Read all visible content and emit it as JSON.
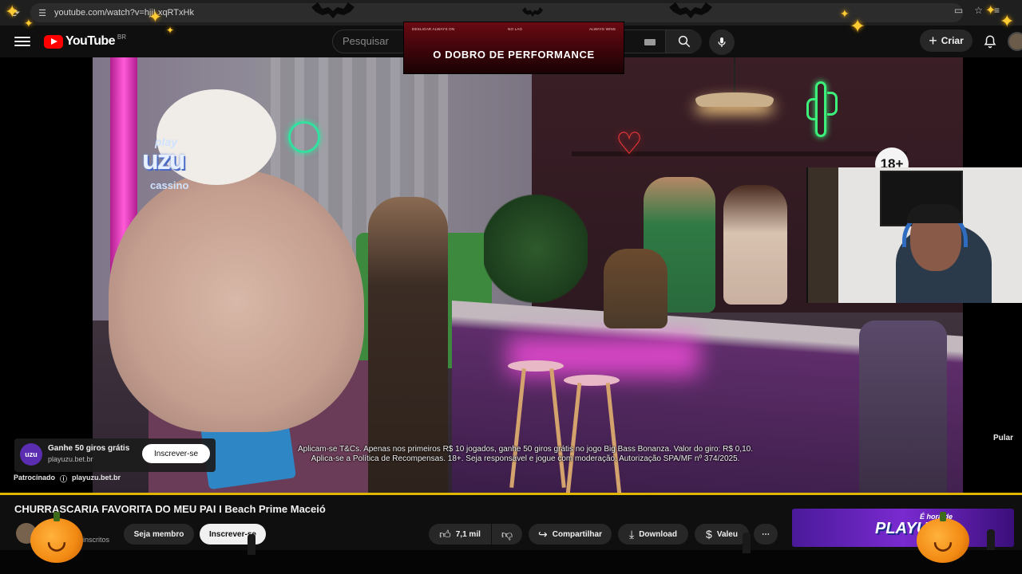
{
  "browser": {
    "url": "youtube.com/watch?v=hjjLxqRTxHk",
    "reload_icon": "reload-icon",
    "site_info_icon": "site-info-icon"
  },
  "header": {
    "logo_text": "YouTube",
    "region": "BR",
    "search_placeholder": "Pesquisar",
    "create_label": "Criar",
    "icons": [
      "menu-icon",
      "search-icon",
      "mic-icon",
      "bell-icon"
    ]
  },
  "top_ad": {
    "small_1": "DESLIGAR ALWAYS ON",
    "small_2": "NO LAG",
    "small_3": "ALWAYS WINS",
    "headline": "O DOBRO DE PERFORMANCE"
  },
  "video_overlay": {
    "brand_line1": "play",
    "brand_line2": "uzu",
    "brand_line3": "cassino",
    "age_badge": "18+",
    "disclaimer_1": "Aplicam-se T&Cs. Apenas nos primeiros R$ 10 jogados, ganhe 50 giros grátis no jogo Big Bass Bonanza. Valor do giro: R$ 0,10.",
    "disclaimer_2": "Aplica-se a Política de Recompensas. 18+. Seja responsável e jogue com moderação. Autorização SPA/MF nº 374/2025.",
    "skip_label": "Pular"
  },
  "ad_card": {
    "logo_text": "uzu",
    "title": "Ganhe 50 giros grátis",
    "domain": "playuzu.bet.br",
    "cta": "Inscrever-se",
    "sponsored_label": "Patrocinado",
    "sponsored_domain": "playuzu.bet.br"
  },
  "video_info": {
    "title": "CHURRASCARIA FAVORITA DO MEU PAI I Beach Prime Maceió",
    "subscribers": "inscritos",
    "join_label": "Seja membro",
    "subscribe_label": "Inscrever-se",
    "likes": "7,1 mil",
    "share_label": "Compartilhar",
    "download_label": "Download",
    "thanks_label": "Valeu"
  },
  "sidebar_ad": {
    "small": "É hora de",
    "brand": "PLAYUZU"
  },
  "colors": {
    "accent_red": "#ff0000",
    "progress": "#e0b600",
    "background": "#0f0f0f"
  }
}
